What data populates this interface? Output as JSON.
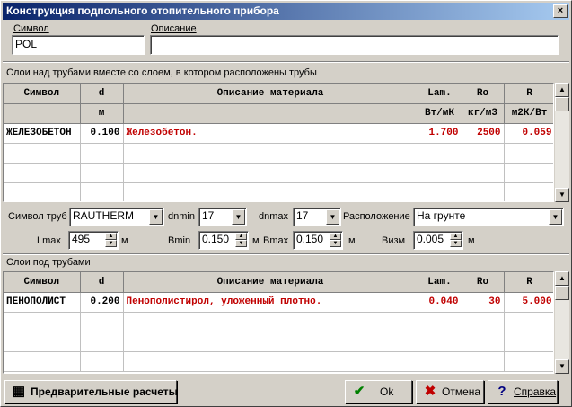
{
  "window": {
    "title": "Конструкция подпольного отопительного прибора",
    "close": "×"
  },
  "symbol": {
    "label": "Символ",
    "value": "POL"
  },
  "description": {
    "label": "Описание",
    "value": ""
  },
  "upper": {
    "caption": "Слои над трубами вместе со слоем, в котором расположены трубы",
    "headers": [
      "Символ",
      "d",
      "Описание материала",
      "Lam.",
      "Ro",
      "R"
    ],
    "units": [
      "",
      "м",
      "",
      "Вт/мК",
      "кг/м3",
      "м2К/Вт"
    ],
    "rows": [
      {
        "symbol": "ЖЕЛЕЗОБЕТОН",
        "d": "0.100",
        "desc": "Железобетон.",
        "lam": "1.700",
        "ro": "2500",
        "r": "0.059"
      }
    ]
  },
  "pipes": {
    "symbol_label": "Символ труб",
    "symbol_value": "RAUTHERM",
    "dnmin_label": "dnmin",
    "dnmin_value": "17",
    "dnmax_label": "dnmax",
    "dnmax_value": "17",
    "location_label": "Расположение",
    "location_value": "На грунте",
    "lmax_label": "Lmax",
    "lmax_value": "495",
    "lmax_unit": "м",
    "bmin_label": "Bmin",
    "bmin_value": "0.150",
    "bmin_unit": "м",
    "bmax_label": "Bmax",
    "bmax_value": "0.150",
    "bmax_unit": "м",
    "bizm_label": "Визм",
    "bizm_value": "0.005",
    "bizm_unit": "м"
  },
  "lower": {
    "caption": "Слои под трубами",
    "headers": [
      "Символ",
      "d",
      "Описание материала",
      "Lam.",
      "Ro",
      "R"
    ],
    "rows": [
      {
        "symbol": "ПЕНОПОЛИСТ",
        "d": "0.200",
        "desc": "Пенополистирол, уложенный плотно.",
        "lam": "0.040",
        "ro": "30",
        "r": "5.000"
      }
    ]
  },
  "buttons": {
    "precalc": "Предварительные расчеты",
    "ok": "Ok",
    "cancel": "Отмена",
    "help": "Справка"
  }
}
